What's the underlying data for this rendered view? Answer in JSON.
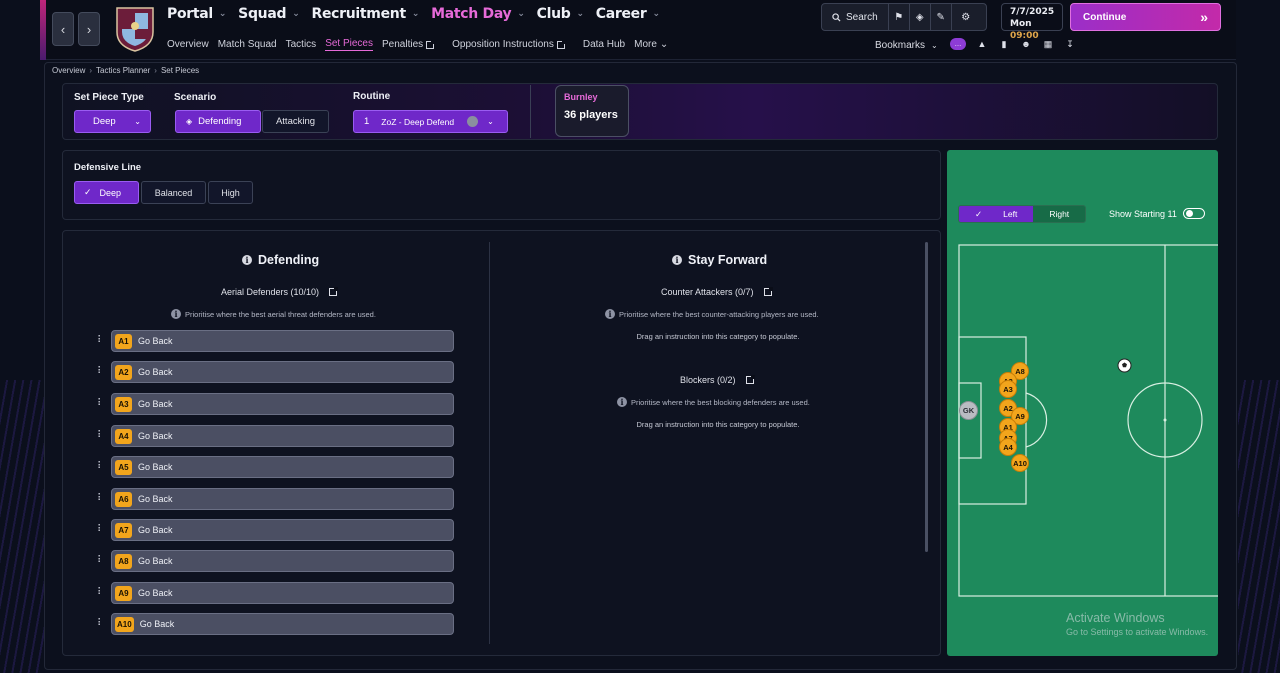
{
  "nav": {
    "main": [
      {
        "label": "Portal",
        "active": false
      },
      {
        "label": "Squad",
        "active": false
      },
      {
        "label": "Recruitment",
        "active": false
      },
      {
        "label": "Match Day",
        "active": true
      },
      {
        "label": "Club",
        "active": false
      },
      {
        "label": "Career",
        "active": false
      }
    ],
    "sub": [
      {
        "label": "Overview",
        "active": false,
        "external": false
      },
      {
        "label": "Match Squad",
        "active": false,
        "external": false
      },
      {
        "label": "Tactics",
        "active": false,
        "external": false
      },
      {
        "label": "Set Pieces",
        "active": true,
        "external": false
      },
      {
        "label": "Penalties",
        "active": false,
        "external": true
      },
      {
        "label": "Opposition Instructions",
        "active": false,
        "external": true
      },
      {
        "label": "Data Hub",
        "active": false,
        "external": false
      },
      {
        "label": "More",
        "active": false,
        "external": false,
        "dropdown": true
      }
    ]
  },
  "header": {
    "search_label": "Search",
    "date": "7/7/2025",
    "day": "Mon",
    "time": "09:00",
    "continue_label": "Continue",
    "bookmarks_label": "Bookmarks"
  },
  "breadcrumb": [
    "Overview",
    "Tactics Planner",
    "Set Pieces"
  ],
  "filters": {
    "set_piece_type_label": "Set Piece Type",
    "set_piece_type_value": "Deep",
    "scenario_label": "Scenario",
    "scenario_options": [
      "Defending",
      "Attacking"
    ],
    "scenario_selected": "Defending",
    "routine_label": "Routine",
    "routine_number": "1",
    "routine_name": "ZoZ - Deep Defend"
  },
  "team": {
    "name": "Burnley",
    "players": "36 players"
  },
  "defensive_line": {
    "label": "Defensive Line",
    "options": [
      "Deep",
      "Balanced",
      "High"
    ],
    "selected": "Deep"
  },
  "defending": {
    "title": "Defending",
    "aerial_title": "Aerial Defenders (10/10)",
    "aerial_hint": "Prioritise where the best aerial threat defenders are used.",
    "rows": [
      {
        "badge": "A1",
        "text": "Go Back"
      },
      {
        "badge": "A2",
        "text": "Go Back"
      },
      {
        "badge": "A3",
        "text": "Go Back"
      },
      {
        "badge": "A4",
        "text": "Go Back"
      },
      {
        "badge": "A5",
        "text": "Go Back"
      },
      {
        "badge": "A6",
        "text": "Go Back"
      },
      {
        "badge": "A7",
        "text": "Go Back"
      },
      {
        "badge": "A8",
        "text": "Go Back"
      },
      {
        "badge": "A9",
        "text": "Go Back"
      },
      {
        "badge": "A10",
        "text": "Go Back"
      }
    ]
  },
  "stay_forward": {
    "title": "Stay Forward",
    "counter_title": "Counter Attackers (0/7)",
    "counter_hint": "Prioritise where the best counter-attacking players are used.",
    "counter_drag": "Drag an instruction into this category to populate.",
    "blockers_title": "Blockers (0/2)",
    "blockers_hint": "Prioritise where the best blocking defenders are used.",
    "blockers_drag": "Drag an instruction into this category to populate."
  },
  "pitch": {
    "side_options": [
      "Left",
      "Right"
    ],
    "side_selected": "Left",
    "show_starting_label": "Show Starting 11",
    "show_starting_on": false,
    "gk_label": "GK",
    "markers": [
      "A8",
      "A3",
      "A3",
      "A2",
      "A9",
      "A1",
      "A7",
      "A4",
      "A10"
    ]
  },
  "watermark": {
    "line1": "Activate Windows",
    "line2": "Go to Settings to activate Windows."
  },
  "colors": {
    "accent": "#6f28c9",
    "brand_pink": "#e66ad8",
    "badge": "#f2a51c",
    "pitch": "#1e8a5c"
  }
}
